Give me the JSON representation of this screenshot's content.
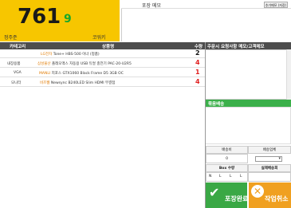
{
  "order": {
    "number": "761",
    "suffix": "9",
    "status": "정주준",
    "code": "코워키"
  },
  "memo": {
    "title": "포장 메모",
    "button_label": "추가메모 (저장)"
  },
  "table": {
    "headers": {
      "category": "카테고리",
      "product": "상품명",
      "qty": "수량"
    },
    "rows": [
      {
        "category": "",
        "brand": "LG전자",
        "product": "Tone+ HBS-500 이너 (정품)",
        "qty": "2",
        "qty_color": "#111111"
      },
      {
        "category": "내장용품",
        "brand": "삼성물산",
        "product": "폴레오맥스 자동용 USB 듀얼 충전기 PAC-20-U2R5",
        "qty": "4",
        "qty_color": "#e02020"
      },
      {
        "category": "VGA",
        "brand": "MANLI",
        "product": "지포스 GTX1060 Black Frame D5 3GB OC",
        "qty": "1",
        "qty_color": "#e02020"
      },
      {
        "category": "모니터",
        "brand": "비즈웹",
        "product": "Newsync B240LED Slim HDMI 무결점",
        "qty": "4",
        "qty_color": "#e02020"
      }
    ]
  },
  "right_panel": {
    "header": "주문시 요청사항 메모/고객메모",
    "gift_label": "묶음배송"
  },
  "shipping": {
    "method_label": "배송비",
    "company_label": "배송업체",
    "method_value": "0",
    "company_value": "",
    "box_label": "Box 수량",
    "weight_label": "실제배송회",
    "box_values": [
      "N",
      "L",
      "L",
      "L"
    ],
    "weight_value": ""
  },
  "buttons": {
    "complete": "포장완료",
    "cancel": "작업취소"
  },
  "colors": {
    "order_bg": "#f7c600",
    "suffix": "#17a82c",
    "header_bar": "#4d4d4d",
    "gift_bar": "#3bb04a",
    "complete_btn": "#3aa845",
    "cancel_btn": "#f0a020",
    "brand_text": "#e07a00"
  }
}
